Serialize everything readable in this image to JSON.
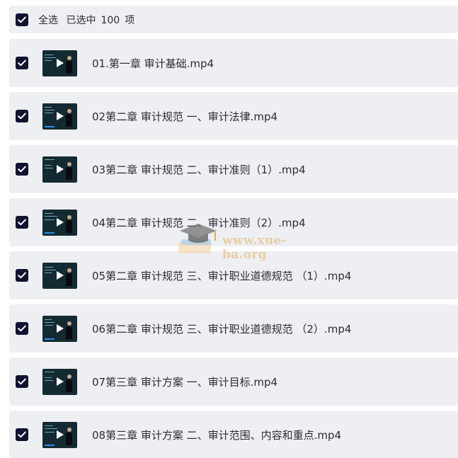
{
  "header": {
    "select_all_label": "全选",
    "selected_prefix": "已选中",
    "selected_count": "100",
    "selected_suffix": "项",
    "checked": true
  },
  "items": [
    {
      "name": "01.第一章 审计基础.mp4",
      "checked": true
    },
    {
      "name": "02第二章 审计规范 一、审计法律.mp4",
      "checked": true
    },
    {
      "name": "03第二章 审计规范 二、审计准则（1）.mp4",
      "checked": true
    },
    {
      "name": "04第二章 审计规范 二、审计准则（2）.mp4",
      "checked": true
    },
    {
      "name": "05第二章 审计规范 三、审计职业道德规范 （1）.mp4",
      "checked": true
    },
    {
      "name": "06第二章 审计规范 三、审计职业道德规范 （2）.mp4",
      "checked": true
    },
    {
      "name": "07第三章 审计方案 一、审计目标.mp4",
      "checked": true
    },
    {
      "name": "08第三章 审计方案 二、审计范围、内容和重点.mp4",
      "checked": true
    }
  ],
  "icons": {
    "checkbox": "checkmark-icon",
    "play": "play-icon",
    "watermark_logo": "graduation-cap-icon"
  },
  "colors": {
    "checkbox_fill": "#0f1330",
    "row_background": "#eeeff2",
    "text": "#2a2d38",
    "thumbnail": "#142a33"
  },
  "watermark": {
    "text": "www.xue-ba.org"
  }
}
